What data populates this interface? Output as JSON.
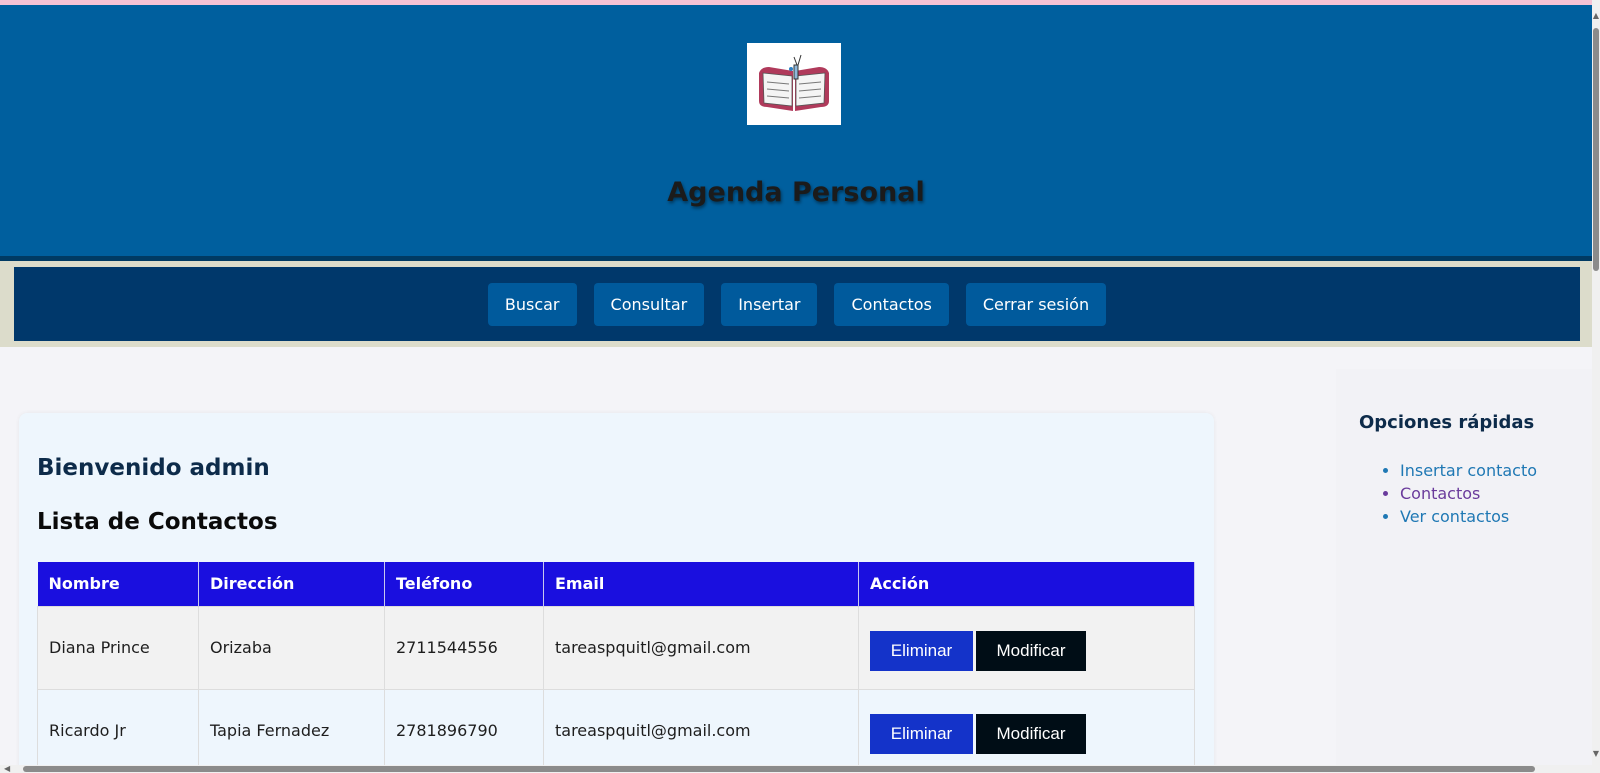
{
  "header": {
    "logo_icon": "agenda-book-icon",
    "title": "Agenda Personal"
  },
  "nav": {
    "items": [
      {
        "label": "Buscar"
      },
      {
        "label": "Consultar"
      },
      {
        "label": "Insertar"
      },
      {
        "label": "Contactos"
      },
      {
        "label": "Cerrar sesión"
      }
    ]
  },
  "main": {
    "welcome": "Bienvenido admin",
    "list_title": "Lista de Contactos",
    "table": {
      "headers": [
        "Nombre",
        "Dirección",
        "Teléfono",
        "Email",
        "Acción"
      ],
      "rows": [
        {
          "nombre": "Diana Prince",
          "direccion": "Orizaba",
          "telefono": "2711544556",
          "email": "tareaspquitl@gmail.com"
        },
        {
          "nombre": "Ricardo Jr",
          "direccion": "Tapia Fernadez",
          "telefono": "2781896790",
          "email": "tareaspquitl@gmail.com"
        }
      ],
      "delete_label": "Eliminar",
      "modify_label": "Modificar"
    }
  },
  "aside": {
    "title": "Opciones rápidas",
    "links": [
      {
        "label": "Insertar contacto"
      },
      {
        "label": "Contactos"
      },
      {
        "label": "Ver contactos"
      }
    ]
  },
  "colors": {
    "header_bg": "#005f9e",
    "nav_bg": "#00386b",
    "nav_button": "#005a9c",
    "table_header": "#1a0fdf",
    "delete_button": "#1433c9",
    "modify_button": "#000d16",
    "link": "#1f78b4",
    "visited_link": "#6a3b9c"
  }
}
